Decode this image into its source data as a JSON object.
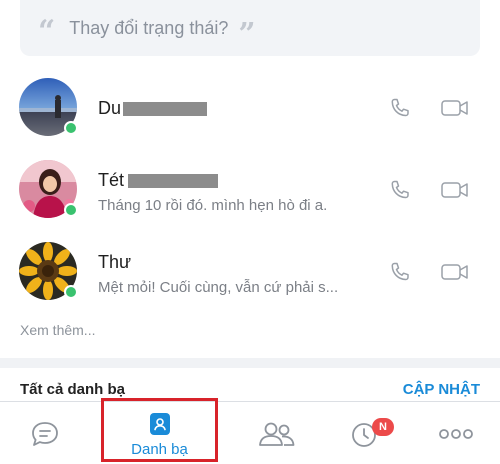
{
  "status": {
    "placeholder": "Thay đổi trạng thái?"
  },
  "contacts": [
    {
      "name": "Du",
      "message": "",
      "online": true
    },
    {
      "name": "Tét",
      "message": "Tháng 10 rồi đó. mình hẹn hò đi a.",
      "online": true
    },
    {
      "name": "Thư",
      "message": "Mệt mỏi! Cuối cùng, vẫn cứ phải s...",
      "online": true
    }
  ],
  "see_more": "Xem thêm...",
  "section": {
    "title": "Tất cả danh bạ",
    "action": "CẬP NHẬT"
  },
  "bottom_nav": {
    "items": [
      {
        "icon": "chat-bubble-icon",
        "label": ""
      },
      {
        "icon": "contacts-icon",
        "label": "Danh bạ",
        "active": true
      },
      {
        "icon": "group-icon",
        "label": ""
      },
      {
        "icon": "clock-icon",
        "label": "",
        "badge": "N"
      },
      {
        "icon": "more-icon",
        "label": ""
      }
    ]
  },
  "colors": {
    "accent": "#1a8bd8",
    "online": "#3ac26f",
    "badge": "#ec4a4a",
    "highlight_frame": "#d8232a"
  }
}
